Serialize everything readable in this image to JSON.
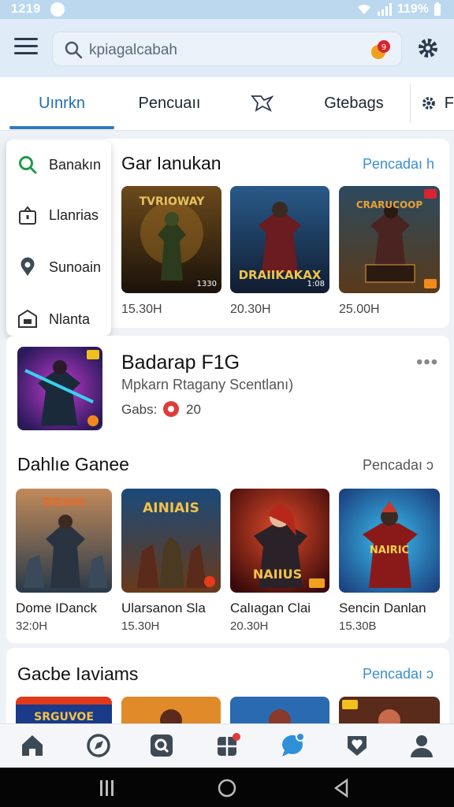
{
  "status_bar": {
    "time": "1219",
    "battery": "119%"
  },
  "search": {
    "placeholder": "kpiagalcabah",
    "badge_count": "9"
  },
  "tabs": [
    {
      "label": "Uınrkn",
      "active": true
    },
    {
      "label": "Pencuaıı"
    },
    {
      "label": "",
      "icon": "heart-tag-icon"
    },
    {
      "label": "Gtebags"
    },
    {
      "label": "F",
      "icon": "gear-icon"
    }
  ],
  "dropdown": [
    {
      "label": "Banakın",
      "icon": "search-icon"
    },
    {
      "label": "Llanrias",
      "icon": "lock-icon"
    },
    {
      "label": "Sunoain",
      "icon": "location-pin-icon"
    },
    {
      "label": "Nlanta",
      "icon": "folder-icon"
    }
  ],
  "section_1": {
    "title": "Gar Ianukan",
    "link": "Pencadaı h",
    "tiles": [
      {
        "overlay": "TVRIOWAY",
        "badge": "1330",
        "meta": "15.30H"
      },
      {
        "overlay": "DRAIIKAKAX",
        "badge": "1:08",
        "meta": "20.30H"
      },
      {
        "overlay": "CRARUCOOP",
        "badge": "",
        "meta": "25.00H"
      }
    ]
  },
  "featured": {
    "title": "Badarap F1G",
    "subtitle": "Mpkarn Rtagany Scentlanı)",
    "rating_label": "Gabs:",
    "rating_value": "20",
    "more": "•••"
  },
  "section_2": {
    "title": "Dahlıe Ganee",
    "link": "Pencadaı ɔ",
    "games": [
      {
        "name": "Dome IDanck",
        "meta": "32:0H",
        "overlay": "DOAIII"
      },
      {
        "name": "Ularsanon Sla",
        "meta": "15.30H",
        "overlay": "AINIAIS"
      },
      {
        "name": "Calıagan Clai",
        "meta": "20.30H",
        "overlay": "NAIIUS"
      },
      {
        "name": "Sencin Danlan",
        "meta": "15.30B",
        "overlay": "NAIRIC"
      }
    ]
  },
  "section_3": {
    "title": "Gacbe Iaviams",
    "link": "Pencadaı ɔ",
    "first_overlay": "SRGUVOE"
  },
  "bottom_nav": [
    "home-icon",
    "compass-icon",
    "search-icon",
    "puzzle-icon",
    "chat-icon",
    "heart-icon",
    "profile-icon"
  ],
  "colors": {
    "accent": "#2f7bc0",
    "link": "#3a8fcf",
    "appbar": "#dfecf7"
  }
}
